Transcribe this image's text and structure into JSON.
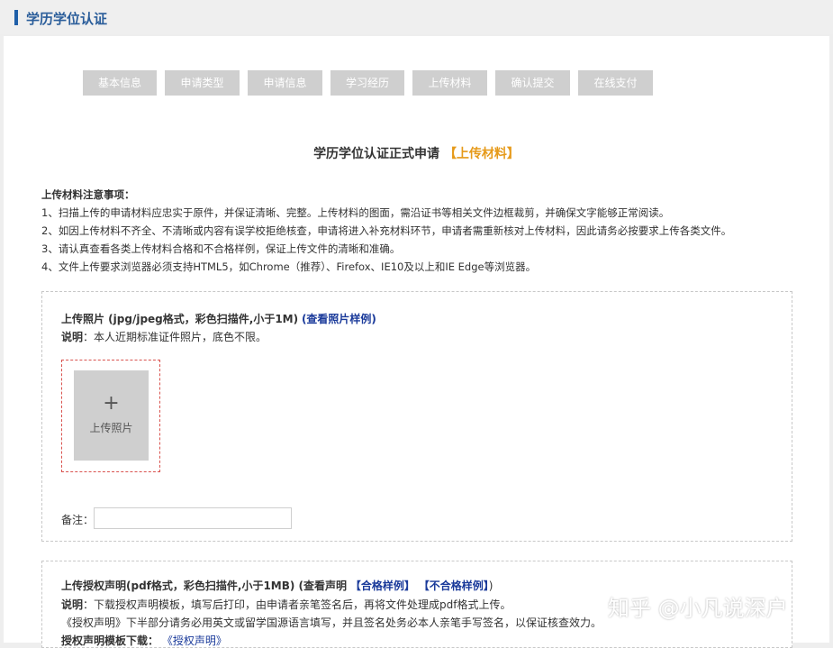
{
  "header": {
    "title": "学历学位认证"
  },
  "steps": [
    "基本信息",
    "申请类型",
    "申请信息",
    "学习经历",
    "上传材料",
    "确认提交",
    "在线支付"
  ],
  "heading": {
    "main": "学历学位认证正式申请",
    "highlight": "【上传材料】"
  },
  "notes": {
    "title": "上传材料注意事项：",
    "items": [
      "1、扫描上传的申请材料应忠实于原件，并保证清晰、完整。上传材料的图面，需沿证书等相关文件边框裁剪，并确保文字能够正常阅读。",
      "2、如因上传材料不齐全、不清晰或内容有误学校拒绝核查，申请将进入补充材料环节，申请者需重新核对上传材料，因此请务必按要求上传各类文件。",
      "3、请认真查看各类上传材料合格和不合格样例，保证上传文件的清晰和准确。",
      "4、文件上传要求浏览器必须支持HTML5，如Chrome（推荐）、Firefox、IE10及以上和IE Edge等浏览器。"
    ]
  },
  "photo": {
    "title": "上传照片 (jpg/jpeg格式，彩色扫描件,小于1M)",
    "sample_link": "(查看照片样例)",
    "desc_label": "说明",
    "desc_text": "：本人近期标准证件照片，底色不限。",
    "upload_plus": "+",
    "upload_label": "上传照片",
    "remark_label": "备注：",
    "remark_value": ""
  },
  "auth": {
    "title": "上传授权声明(pdf格式，彩色扫描件,小于1MB) (查看声明",
    "qualified": "【合格样例】",
    "unqualified": "【不合格样例】",
    "close_paren": ")",
    "desc_label": "说明",
    "desc_text": "：下载授权声明模板，填写后打印，由申请者亲笔签名后，再将文件处理成pdf格式上传。",
    "line2": "《授权声明》下半部分请务必用英文或留学国源语言填写，并且签名处务必本人亲笔手写签名，以保证核查效力。",
    "download_label": "授权声明模板下载：",
    "download_link": "《授权声明》"
  },
  "watermark": "知乎 @小凡说深户"
}
